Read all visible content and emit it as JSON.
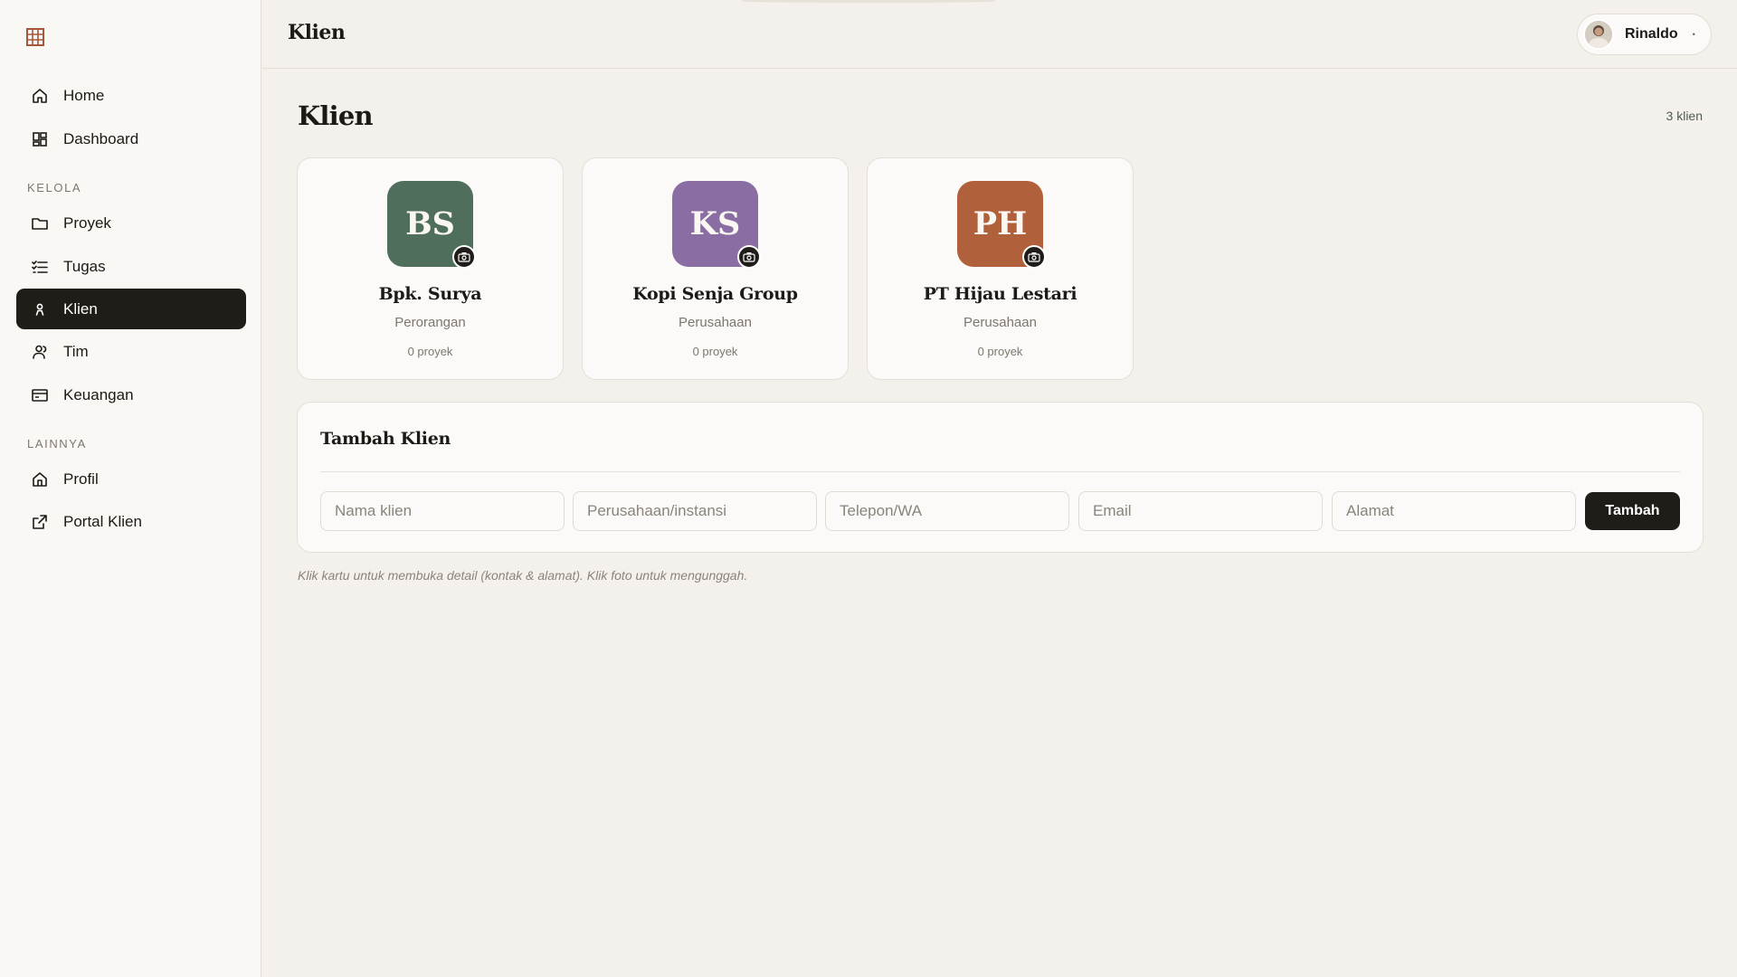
{
  "app": {
    "logo_icon": "grid-logo-icon",
    "brand_color": "#a4583a",
    "accent_dark": "#201d19"
  },
  "sidebar": {
    "items_top": [
      {
        "label": "Home",
        "icon": "home-icon"
      },
      {
        "label": "Dashboard",
        "icon": "dashboard-icon"
      }
    ],
    "section_kelola": "KELOLA",
    "items_kelola": [
      {
        "label": "Proyek",
        "icon": "folder-icon"
      },
      {
        "label": "Tugas",
        "icon": "checklist-icon"
      },
      {
        "label": "Klien",
        "icon": "client-icon",
        "active": true
      },
      {
        "label": "Tim",
        "icon": "team-icon"
      },
      {
        "label": "Keuangan",
        "icon": "wallet-icon"
      }
    ],
    "section_lainnya": "LAINNYA",
    "items_lainnya": [
      {
        "label": "Profil",
        "icon": "profile-home-icon"
      },
      {
        "label": "Portal Klien",
        "icon": "external-link-icon"
      }
    ]
  },
  "header": {
    "title": "Klien",
    "user": {
      "name": "Rinaldo",
      "caret": "•"
    }
  },
  "main": {
    "title": "Klien",
    "count_label": "3 klien",
    "clients": [
      {
        "initials": "BS",
        "name": "Bpk. Surya",
        "type": "Perorangan",
        "projects": "0 proyek",
        "color": "#4f6f5c"
      },
      {
        "initials": "KS",
        "name": "Kopi Senja Group",
        "type": "Perusahaan",
        "projects": "0 proyek",
        "color": "#8a6da3"
      },
      {
        "initials": "PH",
        "name": "PT Hijau Lestari",
        "type": "Perusahaan",
        "projects": "0 proyek",
        "color": "#b0603b"
      }
    ],
    "add_form": {
      "title": "Tambah Klien",
      "placeholders": {
        "name": "Nama klien",
        "company": "Perusahaan/instansi",
        "phone": "Telepon/WA",
        "email": "Email",
        "address": "Alamat"
      },
      "submit_label": "Tambah"
    },
    "hint": "Klik kartu untuk membuka detail (kontak & alamat). Klik foto untuk mengunggah."
  }
}
